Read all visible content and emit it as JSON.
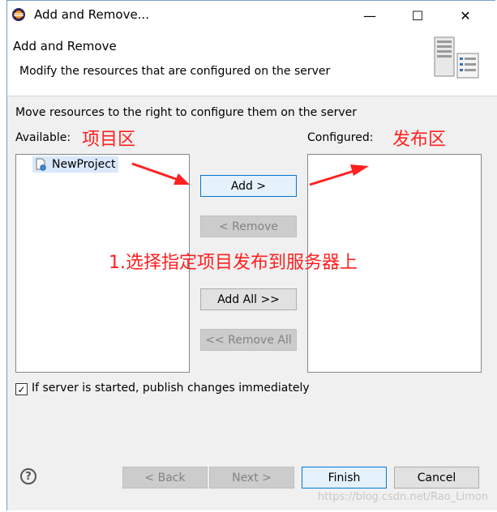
{
  "window": {
    "title": "Add and Remove...",
    "minimize_glyph": "—",
    "maximize_glyph": "☐",
    "close_glyph": "✕"
  },
  "header": {
    "title": "Add and Remove",
    "description": "Modify the resources that are configured on the server"
  },
  "body": {
    "instruction": "Move resources to the right to configure them on the server",
    "available_label": "Available:",
    "configured_label": "Configured:",
    "available_items": [
      "NewProject"
    ],
    "configured_items": []
  },
  "buttons": {
    "add": "Add >",
    "remove": "< Remove",
    "add_all": "Add All >>",
    "remove_all": "<< Remove All"
  },
  "checkbox": {
    "checked": true,
    "label": "If server is started, publish changes immediately"
  },
  "footer": {
    "back": "< Back",
    "next": "Next >",
    "finish": "Finish",
    "cancel": "Cancel"
  },
  "annotations": {
    "left": "项目区",
    "right": "发布区",
    "center": "1.选择指定项目发布到服务器上",
    "color": "#ff2020"
  },
  "watermark": "https://blog.csdn.net/Rao_Limon"
}
